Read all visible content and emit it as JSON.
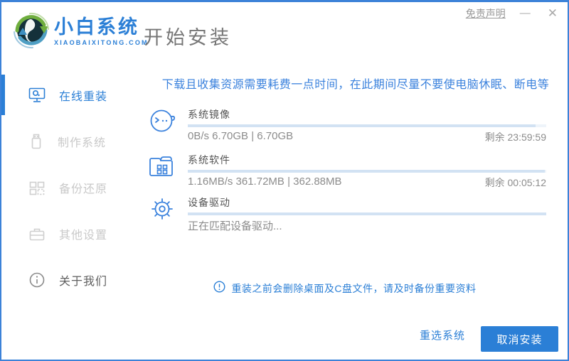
{
  "header": {
    "brand_name": "小白系统",
    "brand_domain": "XIAOBAIXITONG.COM",
    "page_title": "开始安装"
  },
  "titlebar": {
    "disclaimer_label": "免责声明",
    "minimize_glyph": "—",
    "close_glyph": "✕"
  },
  "sidebar": {
    "items": [
      {
        "label": "在线重装",
        "icon": "monitor-icon",
        "active": true
      },
      {
        "label": "制作系统",
        "icon": "usb-icon",
        "active": false
      },
      {
        "label": "备份还原",
        "icon": "backup-grid-icon",
        "active": false
      },
      {
        "label": "其他设置",
        "icon": "toolbox-icon",
        "active": false
      },
      {
        "label": "关于我们",
        "icon": "info-icon",
        "active": false
      }
    ]
  },
  "main": {
    "notice": "下载且收集资源需要耗费一点时间，在此期间尽量不要使电脑休眠、断电等",
    "tasks": [
      {
        "title": "系统镜像",
        "stats": "0B/s 6.70GB | 6.70GB",
        "remaining": "剩余 23:59:59",
        "progress": 97
      },
      {
        "title": "系统软件",
        "stats": "1.16MB/s 361.72MB | 362.88MB",
        "remaining": "剩余 00:05:12",
        "progress": 99.7
      },
      {
        "title": "设备驱动",
        "stats": "正在匹配设备驱动...",
        "remaining": "",
        "progress": 100
      }
    ],
    "warning_note": "重装之前会删除桌面及C盘文件，请及时备份重要资料"
  },
  "footer": {
    "reselect_label": "重选系统",
    "cancel_label": "取消安装"
  },
  "colors": {
    "accent_blue": "#2b7fd6",
    "notice_blue": "#3b82dd",
    "window_border": "#3c82d8",
    "inactive_gray": "#c9c9c9",
    "stats_gray": "#8c8c8c",
    "progress_track": "#eef4fa",
    "progress_fill": "#d2e2f3"
  }
}
